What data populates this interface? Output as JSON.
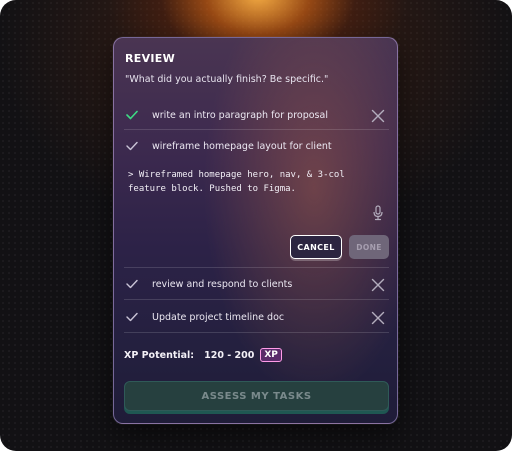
{
  "review": {
    "title": "REVIEW",
    "prompt": "\"What did you actually finish? Be specific.\"",
    "tasks": [
      {
        "label": "write an intro paragraph for proposal",
        "check_color": "#3ddc84"
      },
      {
        "label": "wireframe homepage layout for client",
        "check_color": "#c9c3d6"
      },
      {
        "label": "review and respond to clients",
        "check_color": "#c9c3d6"
      },
      {
        "label": "Update project timeline doc",
        "check_color": "#c9c3d6"
      }
    ],
    "note_text": "> Wireframed homepage hero, nav, & 3-col\nfeature block. Pushed to Figma.",
    "cancel_label": "CANCEL",
    "done_label": "DONE",
    "xp": {
      "label": "XP Potential:",
      "range": "120 - 200",
      "badge": "XP"
    },
    "assess_label": "ASSESS MY TASKS"
  },
  "icons": {
    "check": "check-icon",
    "close": "close-icon",
    "mic": "microphone-icon"
  }
}
